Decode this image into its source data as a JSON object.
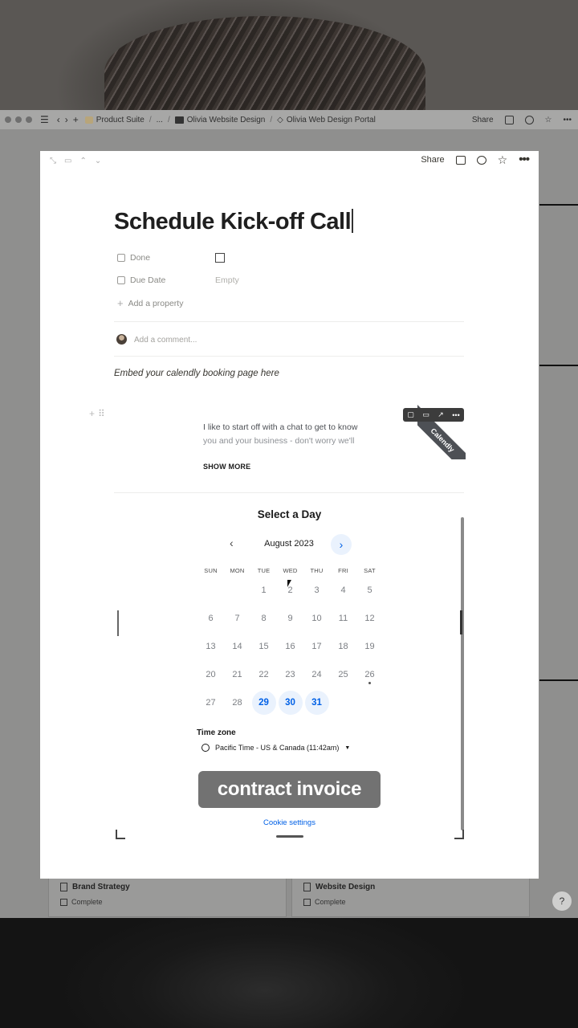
{
  "toolbar": {
    "breadcrumbs": [
      "Product Suite",
      "...",
      "Olivia Website Design",
      "Olivia Web Design Portal"
    ],
    "share": "Share"
  },
  "modal": {
    "share": "Share",
    "title": "Schedule Kick-off Call",
    "properties": [
      {
        "name": "Done",
        "value": ""
      },
      {
        "name": "Due Date",
        "value": "Empty"
      }
    ],
    "add_property": "Add a property",
    "comment_placeholder": "Add a comment...",
    "embed_note": "Embed your calendly booking page here"
  },
  "calendly": {
    "intro_line1": "I like to start off with a chat to get to know",
    "intro_line2": "you and your business - don't worry we'll",
    "show_more": "SHOW MORE",
    "ribbon": "Calendly",
    "select_day": "Select a Day",
    "month": "August 2023",
    "weekdays": [
      "SUN",
      "MON",
      "TUE",
      "WED",
      "THU",
      "FRI",
      "SAT"
    ],
    "weeks": [
      [
        "",
        "",
        "1",
        "2",
        "3",
        "4",
        "5"
      ],
      [
        "6",
        "7",
        "8",
        "9",
        "10",
        "11",
        "12"
      ],
      [
        "13",
        "14",
        "15",
        "16",
        "17",
        "18",
        "19"
      ],
      [
        "20",
        "21",
        "22",
        "23",
        "24",
        "25",
        "26"
      ],
      [
        "27",
        "28",
        "29",
        "30",
        "31",
        "",
        ""
      ]
    ],
    "available_days": [
      "29",
      "30",
      "31"
    ],
    "today": "26",
    "timezone_label": "Time zone",
    "timezone_value": "Pacific Time - US & Canada (11:42am)",
    "cookie_settings": "Cookie settings"
  },
  "caption": "contract invoice",
  "background_cards": [
    {
      "title": "Brand Strategy",
      "status": "Complete"
    },
    {
      "title": "Website Design",
      "status": "Complete"
    }
  ],
  "help": "?",
  "colors": {
    "accent": "#0060e6",
    "available_bg": "#eaf2fd"
  }
}
